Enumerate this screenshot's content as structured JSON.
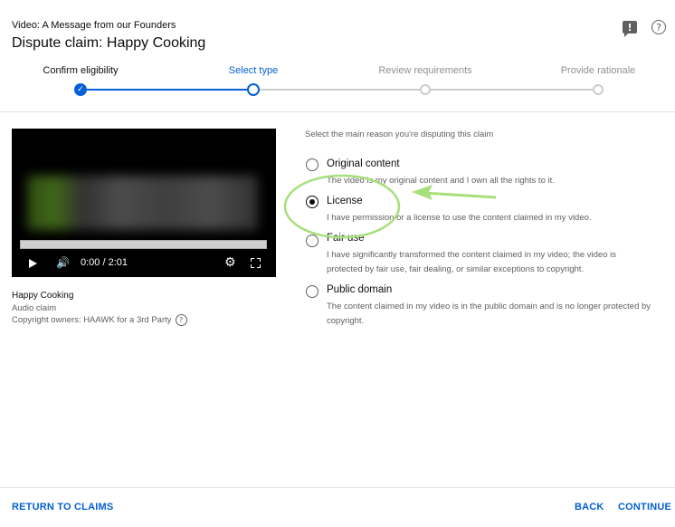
{
  "header": {
    "subtitle": "Video: A Message from our Founders",
    "title": "Dispute claim: Happy Cooking"
  },
  "header_icons": [
    "feedback-icon",
    "help-icon"
  ],
  "stepper": {
    "steps": [
      {
        "label": "Confirm eligibility",
        "state": "done"
      },
      {
        "label": "Select type",
        "state": "active"
      },
      {
        "label": "Review requirements",
        "state": "todo"
      },
      {
        "label": "Provide rationale",
        "state": "todo"
      }
    ]
  },
  "player": {
    "time": "0:00 / 2:01",
    "progress": 0
  },
  "claim": {
    "title": "Happy Cooking",
    "type": "Audio claim",
    "owners": "Copyright owners: HAAWK for a 3rd Party"
  },
  "form": {
    "prompt": "Select the main reason you're disputing this claim",
    "options": [
      {
        "label": "Original content",
        "desc": "The video is my original content and I own all the rights to it.",
        "checked": false
      },
      {
        "label": "License",
        "desc": "I have permission or a license to use the content claimed in my video.",
        "checked": true
      },
      {
        "label": "Fair use",
        "desc": "I have significantly transformed the content claimed in my video; the video is protected by fair use, fair dealing, or similar exceptions to copyright.",
        "checked": false
      },
      {
        "label": "Public domain",
        "desc": "The content claimed in my video is in the public domain and is no longer protected by copyright.",
        "checked": false
      }
    ]
  },
  "footer": {
    "return_label": "RETURN TO CLAIMS",
    "back_label": "BACK",
    "continue_label": "CONTINUE"
  },
  "colors": {
    "accent": "#065fd4",
    "annotation": "#a6e07a"
  }
}
